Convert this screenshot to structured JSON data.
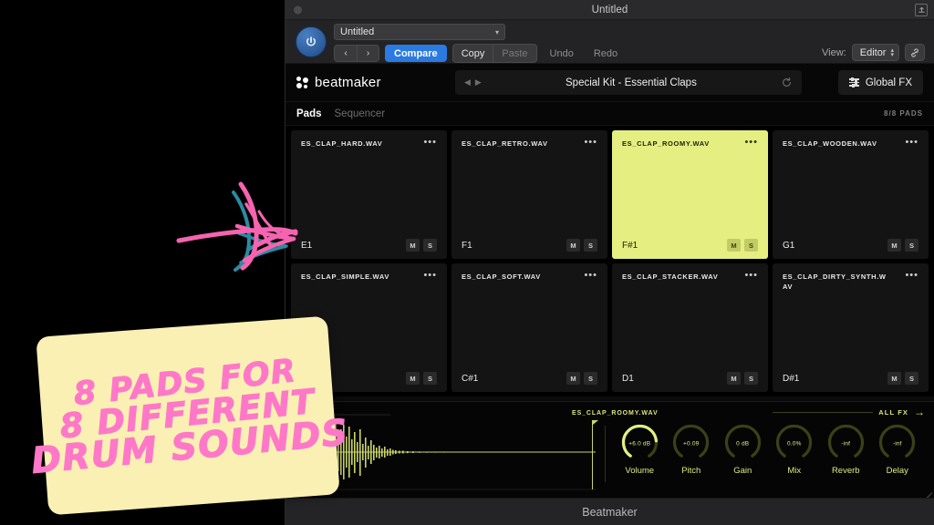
{
  "window": {
    "title": "Untitled",
    "status_title": "Beatmaker",
    "expand_icon": "expand-icon",
    "close_dot": "window-dot"
  },
  "host_toolbar": {
    "power_icon": "power-icon",
    "preset_value": "Untitled",
    "prev_label": "‹",
    "next_label": "›",
    "compare_label": "Compare",
    "copy_label": "Copy",
    "paste_label": "Paste",
    "undo_label": "Undo",
    "redo_label": "Redo",
    "view_label": "View:",
    "view_value": "Editor",
    "link_icon": "link-icon"
  },
  "plugin_header": {
    "brand": "beatmaker",
    "brand_icon": "beatmaker-logo-icon",
    "kit_prev_icon": "triangle-left-icon",
    "kit_next_icon": "triangle-right-icon",
    "kit_name": "Special Kit - Essential Claps",
    "refresh_icon": "refresh-icon",
    "global_fx_label": "Global FX",
    "global_fx_icon": "sliders-icon"
  },
  "tabs": {
    "items": [
      {
        "label": "Pads",
        "active": true
      },
      {
        "label": "Sequencer",
        "active": false
      }
    ],
    "pads_count": "8/8 PADS"
  },
  "pads": [
    {
      "name": "ES_CLAP_HARD.WAV",
      "note": "E1",
      "selected": false,
      "mute": "M",
      "solo": "S"
    },
    {
      "name": "ES_CLAP_RETRO.WAV",
      "note": "F1",
      "selected": false,
      "mute": "M",
      "solo": "S"
    },
    {
      "name": "ES_CLAP_ROOMY.WAV",
      "note": "F#1",
      "selected": true,
      "mute": "M",
      "solo": "S"
    },
    {
      "name": "ES_CLAP_WOODEN.WAV",
      "note": "G1",
      "selected": false,
      "mute": "M",
      "solo": "S"
    },
    {
      "name": "ES_CLAP_SIMPLE.WAV",
      "note": "",
      "selected": false,
      "mute": "M",
      "solo": "S"
    },
    {
      "name": "ES_CLAP_SOFT.WAV",
      "note": "C#1",
      "selected": false,
      "mute": "M",
      "solo": "S"
    },
    {
      "name": "ES_CLAP_STACKER.WAV",
      "note": "D1",
      "selected": false,
      "mute": "M",
      "solo": "S"
    },
    {
      "name": "ES_CLAP_DIRTY_SYNTH.WAV",
      "note": "D#1",
      "selected": false,
      "mute": "M",
      "solo": "S"
    }
  ],
  "editor": {
    "sample_name": "ES_CLAP_ROOMY.WAV",
    "all_fx_label": "ALL FX",
    "all_fx_arrow": "→",
    "knobs": [
      {
        "label": "Volume",
        "value": "+6.0 dB",
        "fill": 0.72
      },
      {
        "label": "Pitch",
        "value": "+0.09",
        "fill": 0.0
      },
      {
        "label": "Gain",
        "value": "0 dB",
        "fill": 0.0
      },
      {
        "label": "Mix",
        "value": "0.0%",
        "fill": 0.0
      },
      {
        "label": "Reverb",
        "value": "-inf",
        "fill": 0.0
      },
      {
        "label": "Delay",
        "value": "-inf",
        "fill": 0.0
      }
    ]
  },
  "annotation": {
    "line1": "8 PADS FOR",
    "line2": "8 DIFFERENT",
    "line3": "DRUM SOUNDS",
    "arrow_icon": "scribble-arrow-icon"
  },
  "colors": {
    "accent_yellow": "#e5ef81",
    "editor_yellow": "#dde678",
    "sticker_bg": "#faf0b4",
    "sticker_text": "#ff78c8",
    "host_accent_blue": "#2a7ae2"
  }
}
